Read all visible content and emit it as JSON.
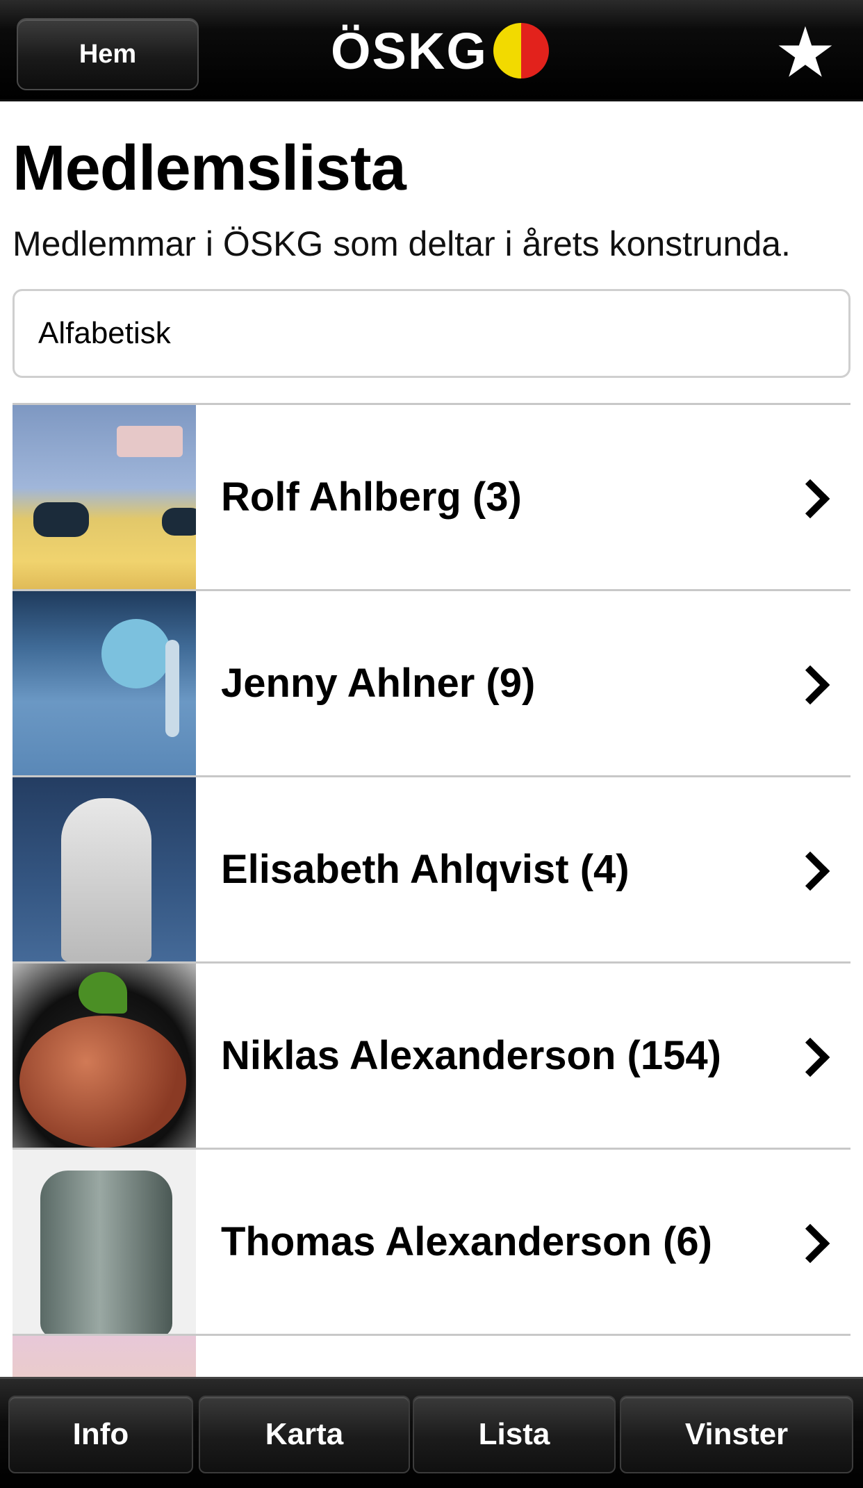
{
  "header": {
    "home_label": "Hem",
    "logo_text": "ÖSKG",
    "star_icon": "star-icon",
    "logo_colors": [
      "#f2da00",
      "#e2221c"
    ]
  },
  "page": {
    "title": "Medlemslista",
    "subtitle": "Medlemmar i ÖSKG som deltar i årets konstrunda."
  },
  "sort": {
    "selected": "Alfabetisk"
  },
  "members": [
    {
      "label": "Rolf Ahlberg (3)"
    },
    {
      "label": "Jenny Ahlner (9)"
    },
    {
      "label": "Elisabeth Ahlqvist (4)"
    },
    {
      "label": "Niklas Alexanderson (154)"
    },
    {
      "label": "Thomas Alexanderson (6)"
    }
  ],
  "tabs": [
    {
      "label": "Info"
    },
    {
      "label": "Karta"
    },
    {
      "label": "Lista"
    },
    {
      "label": "Vinster"
    }
  ]
}
